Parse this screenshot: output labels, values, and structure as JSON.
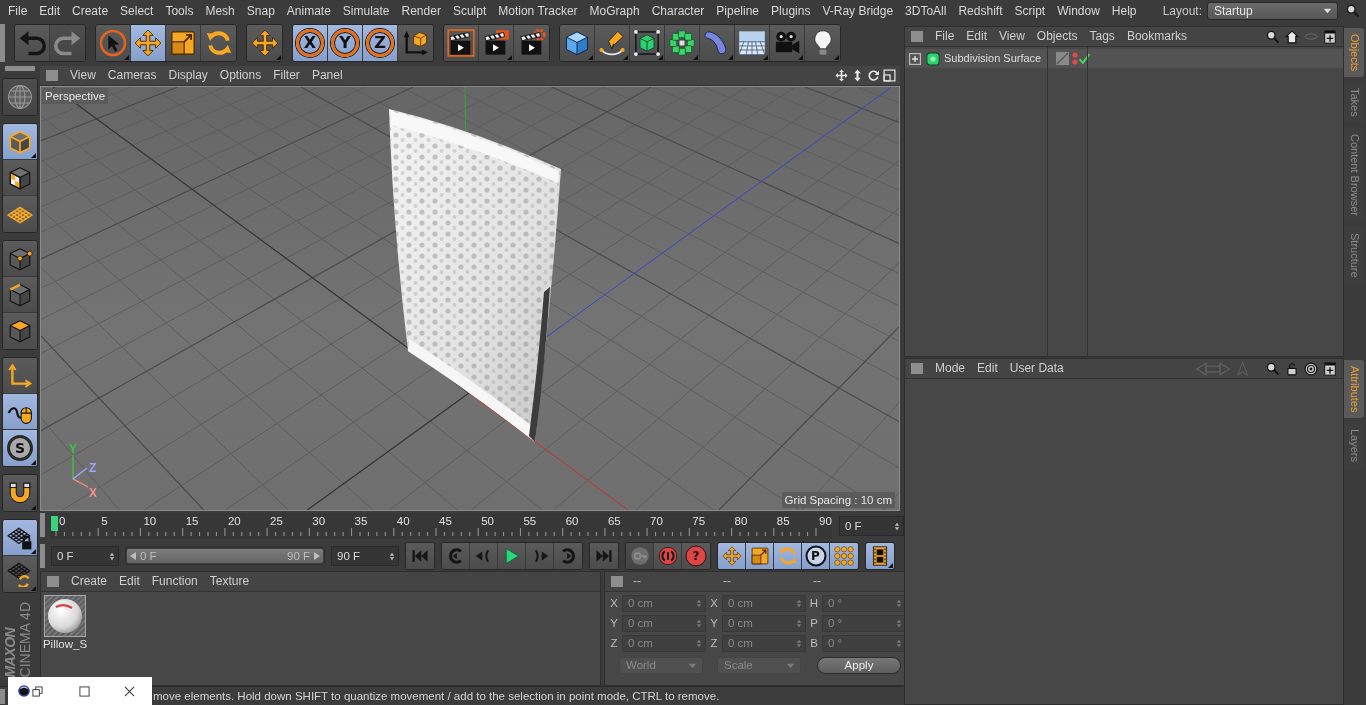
{
  "menu_bar": {
    "items": [
      "File",
      "Edit",
      "Create",
      "Select",
      "Tools",
      "Mesh",
      "Snap",
      "Animate",
      "Simulate",
      "Render",
      "Sculpt",
      "Motion Tracker",
      "MoGraph",
      "Character",
      "Pipeline",
      "Plugins",
      "V-Ray Bridge",
      "3DToAll",
      "Redshift",
      "Script",
      "Window",
      "Help"
    ],
    "layout_label": "Layout:",
    "layout_value": "Startup"
  },
  "toolbar": [
    {
      "buttons": [
        {
          "kind": "undo",
          "disabled": false
        },
        {
          "kind": "redo",
          "disabled": true
        }
      ]
    },
    {
      "buttons": [
        {
          "kind": "live-select",
          "selected": false
        },
        {
          "kind": "move",
          "selected": true
        },
        {
          "kind": "scale",
          "selected": false
        },
        {
          "kind": "rotate",
          "selected": false
        }
      ]
    },
    {
      "buttons": [
        {
          "kind": "transform",
          "selected": false
        }
      ]
    },
    {
      "buttons": [
        {
          "kind": "axis-lock",
          "glyph": "X",
          "selected": true
        },
        {
          "kind": "axis-lock",
          "glyph": "Y",
          "selected": true
        },
        {
          "kind": "axis-lock",
          "glyph": "Z",
          "selected": true
        },
        {
          "kind": "coord-system",
          "selected": false
        }
      ]
    },
    {
      "buttons": [
        {
          "kind": "render-view"
        },
        {
          "kind": "render-pv"
        },
        {
          "kind": "render-settings"
        }
      ]
    },
    {
      "buttons": [
        {
          "kind": "cube"
        },
        {
          "kind": "pen"
        },
        {
          "kind": "subdivision"
        },
        {
          "kind": "cloner"
        },
        {
          "kind": "deformer"
        },
        {
          "kind": "floor"
        },
        {
          "kind": "camera"
        },
        {
          "kind": "light"
        }
      ]
    }
  ],
  "left_toolbar": [
    {
      "buttons": [
        {
          "kind": "make-editable",
          "disabled": true
        }
      ]
    },
    {
      "buttons": [
        {
          "kind": "model",
          "selected": true
        },
        {
          "kind": "texture",
          "selected": false
        },
        {
          "kind": "workplane",
          "selected": false
        }
      ]
    },
    {
      "buttons": [
        {
          "kind": "points",
          "selected": false
        },
        {
          "kind": "edges",
          "selected": false
        },
        {
          "kind": "polygons",
          "selected": false
        }
      ]
    },
    {
      "buttons": [
        {
          "kind": "axis-mode",
          "selected": false
        },
        {
          "kind": "tweak",
          "selected": true
        },
        {
          "kind": "solo",
          "glyph": "S",
          "selected": true
        }
      ]
    },
    {
      "buttons": [
        {
          "kind": "snap",
          "selected": false
        }
      ]
    },
    {
      "buttons": [
        {
          "kind": "workplane-lock",
          "selected": true
        },
        {
          "kind": "workplane-align",
          "selected": false
        }
      ]
    }
  ],
  "logo": {
    "brand": "MAXON",
    "product": "CINEMA 4D"
  },
  "viewport": {
    "menu": [
      "View",
      "Cameras",
      "Display",
      "Options",
      "Filter",
      "Panel"
    ],
    "camera": "Perspective",
    "grid_spacing": "Grid Spacing : 10 cm",
    "axis_gizmo": [
      {
        "label": "Y",
        "color": "#3cc43c"
      },
      {
        "label": "Z",
        "color": "#9aa6ff"
      },
      {
        "label": "X",
        "color": "#ff8c8c"
      }
    ]
  },
  "timeline": {
    "labels": [
      "0",
      "5",
      "10",
      "15",
      "20",
      "25",
      "30",
      "35",
      "40",
      "45",
      "50",
      "55",
      "60",
      "65",
      "70",
      "75",
      "80",
      "85",
      "90"
    ],
    "playhead": {
      "level": 0
    },
    "current_frame": "0 F"
  },
  "playback": {
    "start_field": "0 F",
    "range": {
      "start": "0 F",
      "end": "90 F",
      "level": 1
    },
    "end_field": "90 F",
    "groups": [
      {
        "buttons": [
          {
            "kind": "go-start"
          }
        ]
      },
      {
        "buttons": [
          {
            "kind": "prev-key"
          },
          {
            "kind": "prev-frame"
          },
          {
            "kind": "play"
          },
          {
            "kind": "next-frame"
          },
          {
            "kind": "next-key"
          }
        ]
      },
      {
        "buttons": [
          {
            "kind": "go-end"
          }
        ]
      },
      {
        "buttons": [
          {
            "kind": "record",
            "disabled": true
          },
          {
            "kind": "autokey",
            "disabled": false
          },
          {
            "kind": "key-selection",
            "glyph": "?",
            "disabled": false
          }
        ]
      },
      {
        "buttons": [
          {
            "kind": "key-pos",
            "selected": true
          },
          {
            "kind": "key-scale",
            "selected": true
          },
          {
            "kind": "key-rot",
            "selected": true
          },
          {
            "kind": "key-param",
            "glyph": "P",
            "selected": true
          },
          {
            "kind": "key-pla",
            "selected": true
          }
        ]
      },
      {
        "buttons": [
          {
            "kind": "timeline",
            "selected": true
          }
        ]
      }
    ]
  },
  "material_manager": {
    "menu": [
      "Create",
      "Edit",
      "Function",
      "Texture"
    ],
    "materials": [
      {
        "name": "Pillow_S"
      }
    ]
  },
  "coordinates": {
    "headers": [
      "--",
      "--",
      "--"
    ],
    "rows": [
      [
        {
          "label": "X",
          "value": "0 cm",
          "disabled": true
        },
        {
          "label": "X",
          "value": "0 cm",
          "disabled": true
        },
        {
          "label": "H",
          "value": "0 °",
          "disabled": true
        }
      ],
      [
        {
          "label": "Y",
          "value": "0 cm",
          "disabled": true
        },
        {
          "label": "Y",
          "value": "0 cm",
          "disabled": true
        },
        {
          "label": "P",
          "value": "0 °",
          "disabled": true
        }
      ],
      [
        {
          "label": "Z",
          "value": "0 cm",
          "disabled": true
        },
        {
          "label": "Z",
          "value": "0 cm",
          "disabled": true
        },
        {
          "label": "B",
          "value": "0 °",
          "disabled": true
        }
      ]
    ],
    "dropdowns": [
      {
        "value": "World",
        "disabled": true
      },
      {
        "value": "Scale",
        "disabled": true
      }
    ],
    "apply": "Apply"
  },
  "status_bar": {
    "text": "move elements. Hold down SHIFT to quantize movement / add to the selection in point mode, CTRL to remove."
  },
  "objects_manager": {
    "menu": [
      "File",
      "Edit",
      "View",
      "Objects",
      "Tags",
      "Bookmarks"
    ],
    "objects": [
      {
        "name": "Subdivision Surface",
        "expanded": false,
        "enabled": true
      }
    ],
    "tabs": [
      {
        "label": "Objects",
        "selected": true
      },
      {
        "label": "Takes",
        "selected": false
      },
      {
        "label": "Content Browser",
        "selected": false
      },
      {
        "label": "Structure",
        "selected": false
      }
    ]
  },
  "attributes_manager": {
    "menu": [
      "Mode",
      "Edit",
      "User Data"
    ],
    "tabs": [
      {
        "label": "Attributes",
        "selected": true
      },
      {
        "label": "Layers",
        "selected": false
      }
    ]
  }
}
